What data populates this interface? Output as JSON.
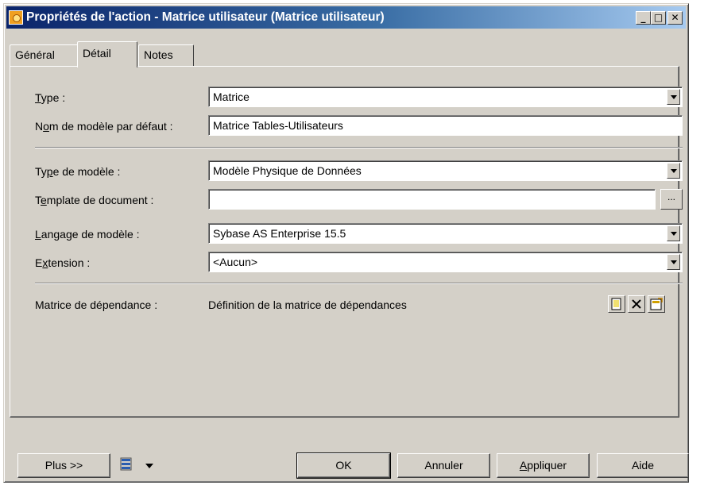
{
  "window": {
    "title": "Propriétés de l'action - Matrice utilisateur (Matrice utilisateur)",
    "controls": {
      "minimize": "_",
      "maximize": "□",
      "close": "✕"
    }
  },
  "tabs": [
    {
      "label": "Général",
      "active": false
    },
    {
      "label": "Détail",
      "active": true
    },
    {
      "label": "Notes",
      "active": false
    }
  ],
  "form": {
    "type": {
      "label_first": "T",
      "label_rest": "ype :",
      "value": "Matrice"
    },
    "default_model_name": {
      "label_pre": "N",
      "label_u": "o",
      "label_rest": "m de modèle par défaut :",
      "value": "Matrice Tables-Utilisateurs"
    },
    "model_type": {
      "label_pre": "Ty",
      "label_u": "p",
      "label_rest": "e de modèle :",
      "value": "Modèle Physique de Données"
    },
    "document_template": {
      "label_pre": "T",
      "label_u": "e",
      "label_rest": "mplate de document :",
      "value": "",
      "browse_label": "..."
    },
    "model_language": {
      "label_first": "L",
      "label_rest": "angage de modèle :",
      "value": "Sybase AS Enterprise 15.5"
    },
    "extension": {
      "label_pre": "E",
      "label_u": "x",
      "label_rest": "tension :",
      "value": "<Aucun>"
    },
    "dependency_matrix": {
      "label": "Matrice de dépendance :",
      "value": "Définition de la matrice de dépendances"
    }
  },
  "footer": {
    "more_label": "Plus >>",
    "ok_label": "OK",
    "cancel_label": "Annuler",
    "apply_first": "A",
    "apply_rest": "ppliquer",
    "help_label": "Aide"
  },
  "icons": {
    "app": "action-properties-icon",
    "new": "new-definition-icon",
    "delete": "delete-icon",
    "properties": "properties-icon",
    "menu": "list-menu-icon"
  }
}
